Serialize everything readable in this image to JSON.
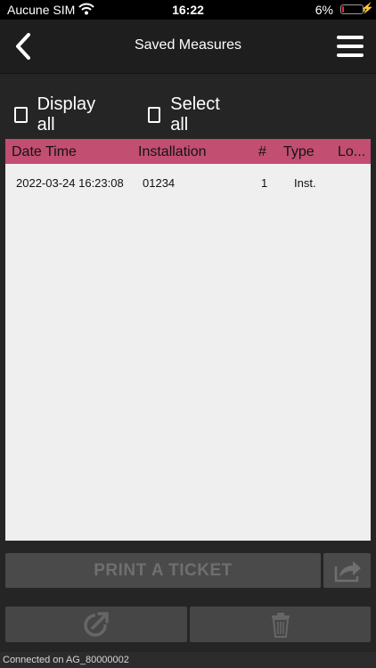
{
  "status_bar": {
    "carrier": "Aucune SIM",
    "time": "16:22",
    "battery_percent": "6%",
    "battery_level": 0.06
  },
  "nav": {
    "title": "Saved Measures",
    "back_icon": "chevron-left-icon",
    "menu_icon": "hamburger-menu-icon"
  },
  "filters": {
    "display_all_label": "Display all",
    "display_all_checked": false,
    "select_all_label": "Select all",
    "select_all_checked": false
  },
  "table": {
    "headers": [
      "Date Time",
      "Installation",
      "#",
      "Type",
      "Lo..."
    ],
    "rows": [
      [
        "2022-03-24 16:23:08",
        "01234",
        "1",
        "Inst.",
        ""
      ]
    ]
  },
  "actions": {
    "print_label": "PRINT A TICKET",
    "share_icon": "share-icon",
    "open_icon": "open-external-icon",
    "delete_icon": "trash-icon"
  },
  "footer": {
    "connection_text": "Connected on AG_80000002"
  },
  "colors": {
    "background": "#252525",
    "header_accent": "#c24e72",
    "battery_low": "#e52d2d"
  }
}
